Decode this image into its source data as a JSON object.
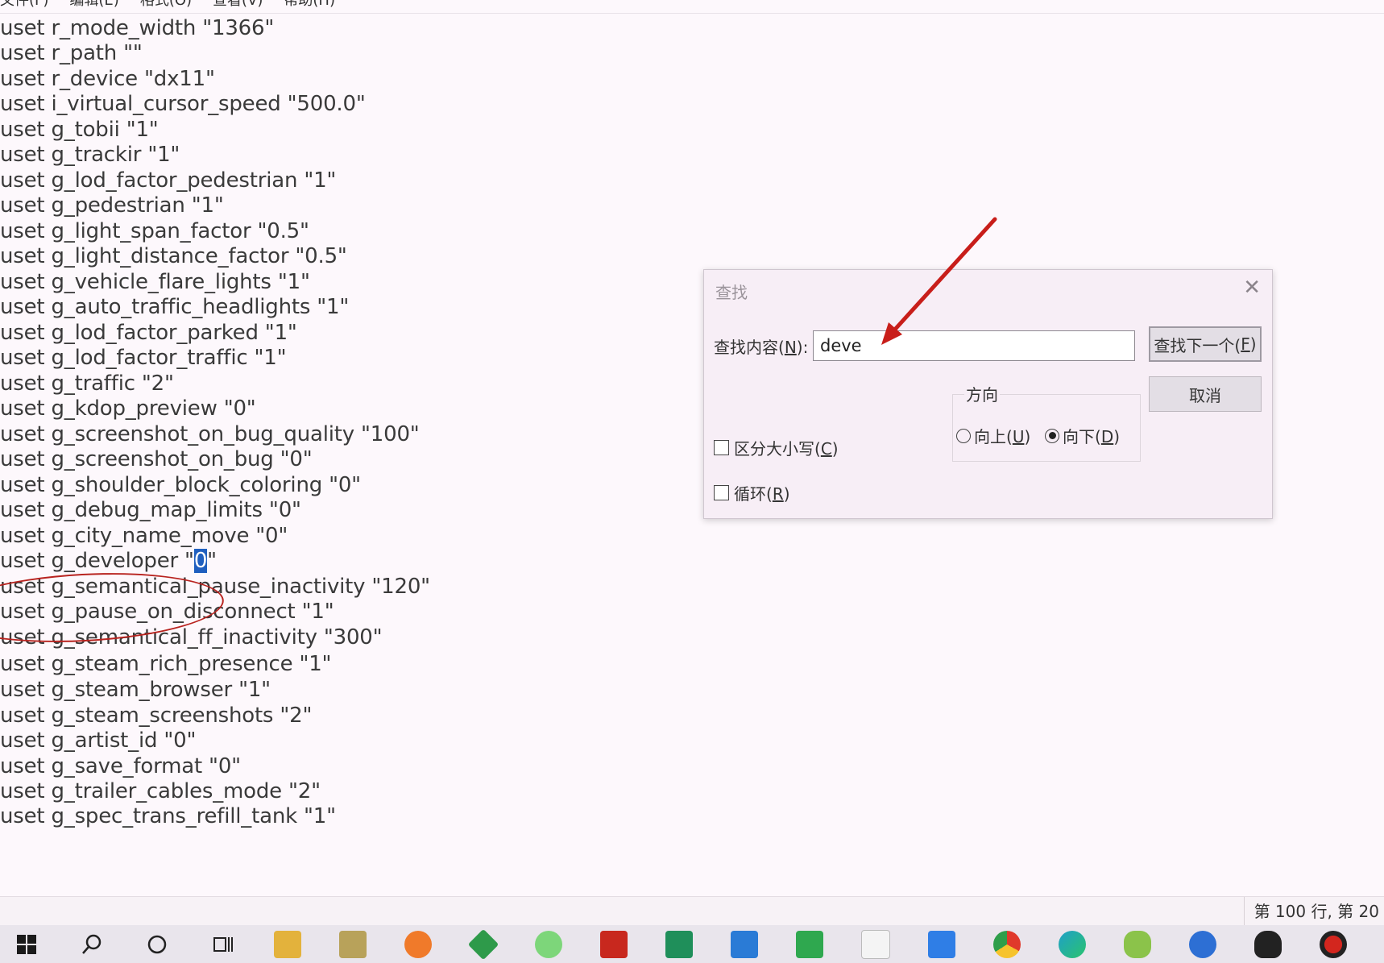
{
  "menu": [
    "文件(F)",
    "编辑(E)",
    "格式(O)",
    "查看(V)",
    "帮助(H)"
  ],
  "lines": [
    "uset r_mode_width \"1366\"",
    "uset r_path \"\"",
    "uset r_device \"dx11\"",
    "uset i_virtual_cursor_speed \"500.0\"",
    "uset g_tobii \"1\"",
    "uset g_trackir \"1\"",
    "uset g_lod_factor_pedestrian \"1\"",
    "uset g_pedestrian \"1\"",
    "uset g_light_span_factor \"0.5\"",
    "uset g_light_distance_factor \"0.5\"",
    "uset g_vehicle_flare_lights \"1\"",
    "uset g_auto_traffic_headlights \"1\"",
    "uset g_lod_factor_parked \"1\"",
    "uset g_lod_factor_traffic \"1\"",
    "uset g_traffic \"2\"",
    "uset g_kdop_preview \"0\"",
    "uset g_screenshot_on_bug_quality \"100\"",
    "uset g_screenshot_on_bug \"0\"",
    "uset g_shoulder_block_coloring \"0\"",
    "uset g_debug_map_limits \"0\"",
    "uset g_city_name_move \"0\"",
    "uset g_developer \"0\"",
    "uset g_semantical_pause_inactivity \"120\"",
    "uset g_pause_on_disconnect \"1\"",
    "uset g_semantical_ff_inactivity \"300\"",
    "uset g_steam_rich_presence \"1\"",
    "uset g_steam_browser \"1\"",
    "uset g_steam_screenshots \"2\"",
    "uset g_artist_id \"0\"",
    "uset g_save_format \"0\"",
    "uset g_trailer_cables_mode \"2\"",
    "uset g_spec_trans_refill_tank \"1\""
  ],
  "developer_line": {
    "prefix": "uset g_developer \"",
    "selected": "0",
    "suffix": "\""
  },
  "status": {
    "position": "第 100 行, 第 20"
  },
  "find_dialog": {
    "title": "查找",
    "close": "✕",
    "label_prefix": "查找内容(",
    "label_key": "N",
    "label_suffix": "):",
    "search_value": "deve",
    "find_next_prefix": "查找下一个(",
    "find_next_key": "F",
    "find_next_suffix": ")",
    "cancel": "取消",
    "direction_legend": "方向",
    "up_prefix": "向上(",
    "up_key": "U",
    "up_suffix": ")",
    "down_prefix": "向下(",
    "down_key": "D",
    "down_suffix": ")",
    "case_prefix": "区分大小写(",
    "case_key": "C",
    "case_suffix": ")",
    "wrap_prefix": "循环(",
    "wrap_key": "R",
    "wrap_suffix": ")",
    "direction_selected": "down",
    "match_case": false,
    "wrap": false
  },
  "taskbar": {
    "icons": [
      "windows-start-icon",
      "search-icon",
      "cortana-icon",
      "task-view-icon",
      "file-explorer-icon",
      "photos-icon",
      "snail-app-icon",
      "diamond-app-icon",
      "wechat-green-icon",
      "app-red-icon",
      "pycharm-icon",
      "vscode-icon",
      "hbuilder-icon",
      "typora-icon",
      "notepad-blue-icon",
      "chrome-icon",
      "edge-icon",
      "game-app-icon",
      "feather-app-icon",
      "qq-icon",
      "record-icon"
    ]
  },
  "colors": {
    "annotation": "#b8231f",
    "selection": "#1f5fbf"
  }
}
